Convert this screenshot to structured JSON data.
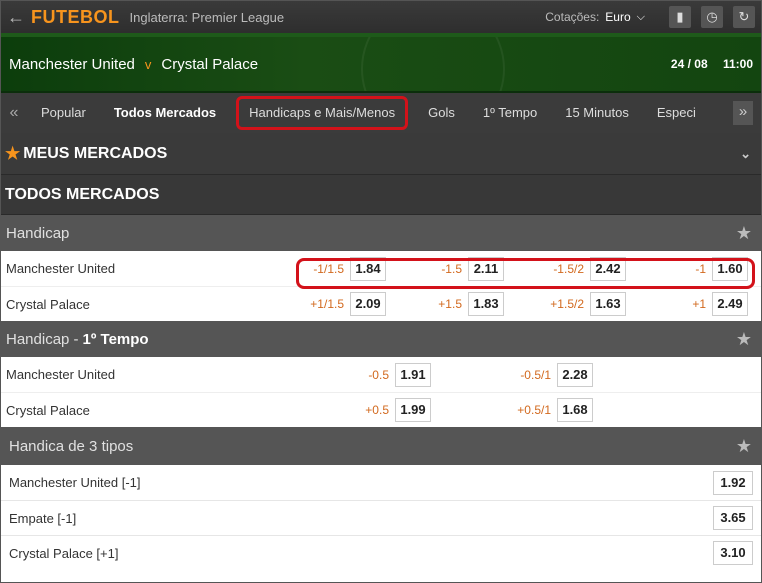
{
  "topbar": {
    "back_icon": "arrow-left-icon",
    "sport": "FUTEBOL",
    "league": "Inglaterra: Premier League",
    "odds_label": "Cotações:",
    "odds_value": "Euro",
    "icons": [
      "bar-chart-icon",
      "clock-icon",
      "refresh-icon"
    ]
  },
  "match": {
    "home": "Manchester United",
    "vs": "v",
    "away": "Crystal Palace",
    "date": "24 / 08",
    "time": "11:00"
  },
  "tabs": [
    "Popular",
    "Todos Mercados",
    "Handicaps e Mais/Menos",
    "Gols",
    "1º Tempo",
    "15 Minutos",
    "Especi"
  ],
  "sections": {
    "meus": "MEUS MERCADOS",
    "todos": "TODOS MERCADOS"
  },
  "handicap": {
    "title": "Handicap",
    "rows": [
      {
        "name": "Manchester United",
        "cells": [
          [
            "-1/1.5",
            "1.84"
          ],
          [
            "-1.5",
            "2.11"
          ],
          [
            "-1.5/2",
            "2.42"
          ],
          [
            "-1",
            "1.60"
          ]
        ]
      },
      {
        "name": "Crystal Palace",
        "cells": [
          [
            "+1/1.5",
            "2.09"
          ],
          [
            "+1.5",
            "1.83"
          ],
          [
            "+1.5/2",
            "1.63"
          ],
          [
            "+1",
            "2.49"
          ]
        ]
      }
    ]
  },
  "handicap_ht": {
    "title": "Handicap -",
    "title_bold": "1º Tempo",
    "rows": [
      {
        "name": "Manchester United",
        "cells": [
          [
            "-0.5",
            "1.91"
          ],
          [
            "-0.5/1",
            "2.28"
          ]
        ]
      },
      {
        "name": "Crystal Palace",
        "cells": [
          [
            "+0.5",
            "1.99"
          ],
          [
            "+0.5/1",
            "1.68"
          ]
        ]
      }
    ]
  },
  "handicap3": {
    "title": "Handica de 3 tipos",
    "rows": [
      {
        "name": "Manchester United [-1]",
        "odd": "1.92"
      },
      {
        "name": "Empate [-1]",
        "odd": "3.65"
      },
      {
        "name": "Crystal Palace [+1]",
        "odd": "3.10"
      }
    ]
  },
  "colors": {
    "accent": "#f7941d",
    "highlight": "#d3121a",
    "header_green": "#1a4d14"
  }
}
